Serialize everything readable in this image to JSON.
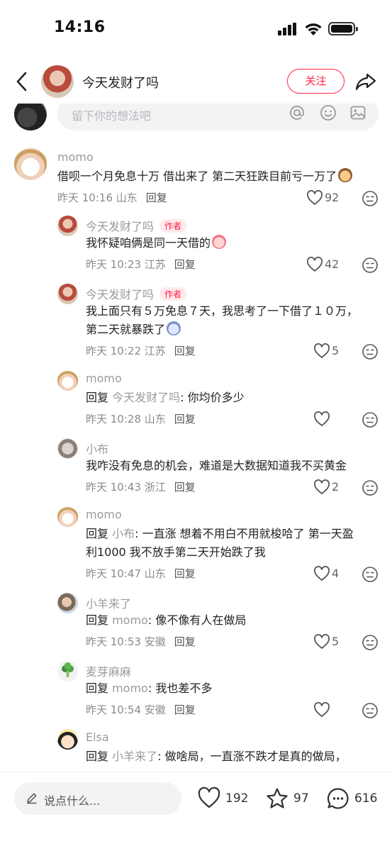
{
  "status_bar": {
    "time": "14:16"
  },
  "header": {
    "title": "今天发财了吗",
    "follow_label": "关注"
  },
  "comment_input": {
    "placeholder": "留下你的想法吧"
  },
  "comments": [
    {
      "name": "momo",
      "author_badge": "",
      "text": "借呗一个月免息十万 借出来了 第二天狂跌目前亏一万了",
      "time": "昨天 10:16 山东",
      "reply_label": "回复",
      "likes": "92"
    },
    {
      "name": "今天发财了吗",
      "author_badge": "作者",
      "text": "我怀疑咱俩是同一天借的",
      "time": "昨天 10:23 江苏",
      "reply_label": "回复",
      "likes": "42"
    },
    {
      "name": "今天发财了吗",
      "author_badge": "作者",
      "text_line1": "我上面只有５万免息７天，我思考了一下借了１０万，",
      "text_line2": "第二天就暴跌了",
      "time": "昨天 10:22 江苏",
      "reply_label": "回复",
      "likes": "5"
    },
    {
      "name": "momo",
      "reply_prefix": "回复 ",
      "reply_to": "今天发财了吗",
      "text": ": 你均价多少",
      "time": "昨天 10:28 山东",
      "reply_label": "回复",
      "likes": ""
    },
    {
      "name": "小布",
      "text": "我咋没有免息的机会，难道是大数据知道我不买黄金",
      "time": "昨天 10:43 浙江",
      "reply_label": "回复",
      "likes": "2"
    },
    {
      "name": "momo",
      "reply_prefix": "回复 ",
      "reply_to": "小布",
      "text_line1": ": 一直涨 想着不用白不用就梭哈了 第一天盈",
      "text_line2": "利1000 我不放手第二天开始跌了我",
      "time": "昨天 10:47 山东",
      "reply_label": "回复",
      "likes": "4"
    },
    {
      "name": "小羊来了",
      "reply_prefix": "回复 ",
      "reply_to": "momo",
      "text": ": 像不像有人在做局",
      "time": "昨天 10:53 安徽",
      "reply_label": "回复",
      "likes": "5"
    },
    {
      "name": "麦芽麻麻",
      "reply_prefix": "回复 ",
      "reply_to": "momo",
      "text": ": 我也差不多",
      "time": "昨天 10:54 安徽",
      "reply_label": "回复",
      "likes": ""
    },
    {
      "name": "Elsa",
      "reply_prefix": "回复 ",
      "reply_to": "小羊来了",
      "text": ": 做啥局，一直涨不跌才是真的做局，"
    }
  ],
  "bottom_bar": {
    "placeholder": "说点什么...",
    "likes": "192",
    "stars": "97",
    "comments": "616"
  },
  "colors": {
    "accent": "#ff2442",
    "muted_text": "#9a9aa0"
  }
}
